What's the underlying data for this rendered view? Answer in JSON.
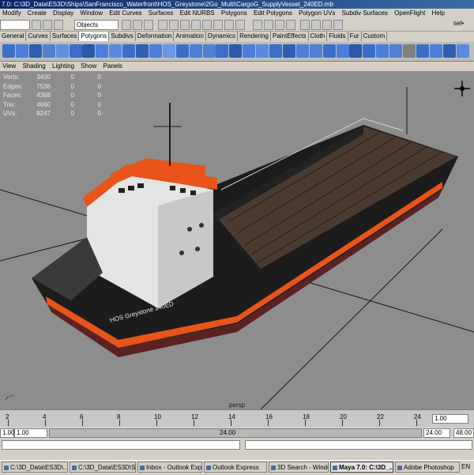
{
  "window": {
    "title": "7.0: C:\\3D_Data\\ES3D\\Ships\\SanFrancisco_Waterfront\\HOS_Greystone\\2Go_Multi\\CargoG_SupplyVessel_240ED.mb"
  },
  "menubar": {
    "items": [
      "Modify",
      "Create",
      "Display",
      "Window",
      "Edit Curves",
      "Surfaces",
      "Edit NURBS",
      "Polygons",
      "Edit Polygons",
      "Polygon UVs",
      "Subdiv Surfaces",
      "OpenFlight",
      "Help"
    ]
  },
  "statusline": {
    "selection_mode": "Objects",
    "sel_label": "sel•"
  },
  "shelf": {
    "tabs": [
      "General",
      "Curves",
      "Surfaces",
      "Polygons",
      "Subdivs",
      "Deformation",
      "Animation",
      "Dynamics",
      "Rendering",
      "PaintEffects",
      "Cloth",
      "Fluids",
      "Fur",
      "Custom"
    ],
    "active_tab": "Polygons",
    "icon_colors": [
      "#3a6ec8",
      "#4a7ed8",
      "#2e5fb0",
      "#5080d0",
      "#6090e0",
      "#3a6ec8",
      "#2a5aa8",
      "#4a7ed8",
      "#5a8ae0",
      "#3a6ec8",
      "#2e5fb0",
      "#4a7ed8",
      "#6a96e6",
      "#3a6ec8",
      "#4a7ed8",
      "#5080d0",
      "#3a6ec8",
      "#2a5aa8",
      "#4a7ed8",
      "#5a8ae0",
      "#3a6ec8",
      "#2e5fb0",
      "#4a7ed8",
      "#5080d0",
      "#3a6ec8",
      "#4a7ed8",
      "#2a5aa8",
      "#3a6ec8",
      "#4a7ed8",
      "#5080d0",
      "#808080",
      "#3a6ec8",
      "#4a7ed8",
      "#2e5fb0",
      "#5a8ae0"
    ]
  },
  "panel_menu": {
    "items": [
      "View",
      "Shading",
      "Lighting",
      "Show",
      "Panels"
    ]
  },
  "hud": {
    "rows": [
      {
        "label": "Verts:",
        "total": "3400",
        "selected": "0",
        "extra": "0"
      },
      {
        "label": "Edges:",
        "total": "7536",
        "selected": "0",
        "extra": "0"
      },
      {
        "label": "Faces:",
        "total": "4368",
        "selected": "0",
        "extra": "0"
      },
      {
        "label": "Tris:",
        "total": "4660",
        "selected": "0",
        "extra": "0"
      },
      {
        "label": "UVs:",
        "total": "9247",
        "selected": "0",
        "extra": "0"
      }
    ]
  },
  "viewport": {
    "camera": "persp",
    "hull_text": "HOS Greystone 240ED"
  },
  "timeslider": {
    "ticks": [
      "2",
      "4",
      "6",
      "8",
      "10",
      "12",
      "14",
      "16",
      "18",
      "20",
      "22",
      "24"
    ],
    "current_frame": "1.00"
  },
  "range": {
    "start": "1.00",
    "range_start": "1.00",
    "range_end_label": "24.00",
    "end": "24.00",
    "anim_end": "48.00"
  },
  "taskbar": {
    "buttons": [
      {
        "label": "C:\\3D_Data\\ES3D\\...",
        "active": false
      },
      {
        "label": "C:\\3D_Data\\ES3D\\S...",
        "active": false
      },
      {
        "label": "Inbox - Outlook Exp...",
        "active": false
      },
      {
        "label": "Outlook Express",
        "active": false
      },
      {
        "label": "3D Search - Windo...",
        "active": false
      },
      {
        "label": "Maya 7.0: C:\\3D_...",
        "active": true
      },
      {
        "label": "Adobe Photoshop",
        "active": false
      }
    ],
    "tray": "EN"
  },
  "colors": {
    "viewport_bg": "#8d8d8d",
    "hull_orange": "#e8541a",
    "hull_black": "#1c1c1c",
    "cabin_white": "#e4e4e4",
    "deck_wood": "#4a3a30"
  }
}
